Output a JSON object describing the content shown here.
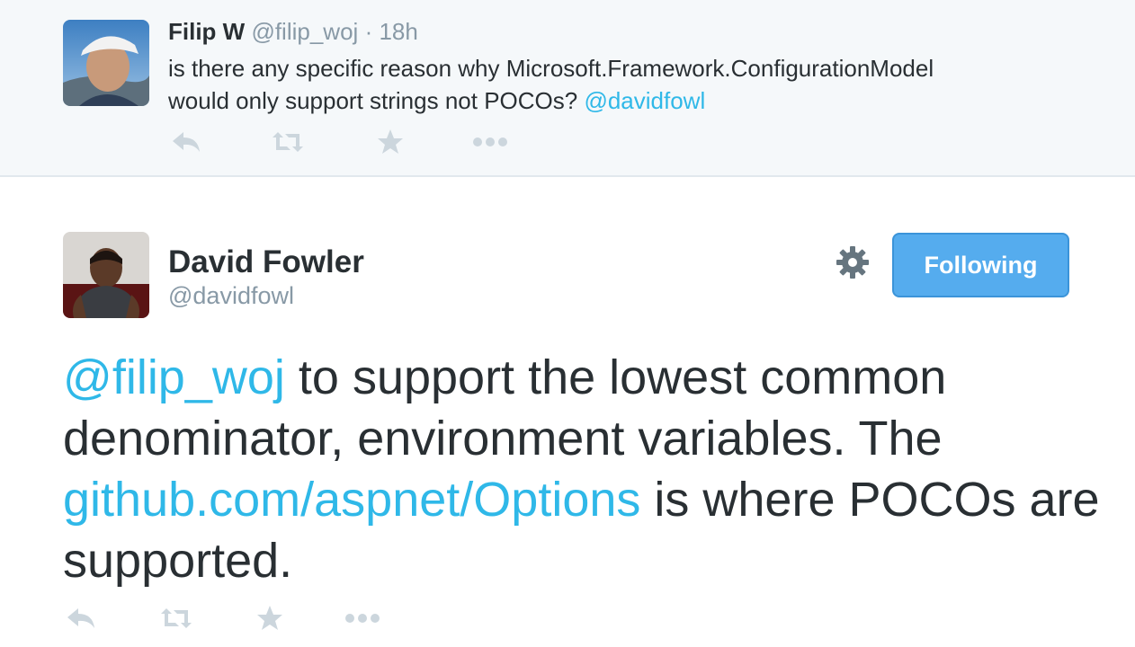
{
  "parent_tweet": {
    "name": "Filip W",
    "handle": "@filip_woj",
    "separator": "·",
    "time": "18h",
    "text_line1": "is there any specific reason why Microsoft.Framework.ConfigurationModel",
    "text_line2": "would only support strings not POCOs?",
    "mention": "@davidfowl",
    "actions": [
      "reply-icon",
      "retweet-icon",
      "favorite-icon",
      "more-icon"
    ]
  },
  "main_tweet": {
    "name": "David Fowler",
    "handle": "@davidfowl",
    "follow_label": "Following",
    "settings_icon": "gear-icon",
    "mention": "@filip_woj",
    "text_part1": " to support the lowest common denominator, environment variables. The ",
    "link": "github.com/aspnet/Options",
    "text_part2": " is where POCOs are supported.",
    "actions": [
      "reply-icon",
      "retweet-icon",
      "favorite-icon",
      "more-icon"
    ]
  },
  "colors": {
    "link": "#2fb8e8",
    "button": "#55acee",
    "muted": "#8899a6",
    "icon": "#ccd6dd",
    "parent_bg": "#f5f8fa"
  }
}
